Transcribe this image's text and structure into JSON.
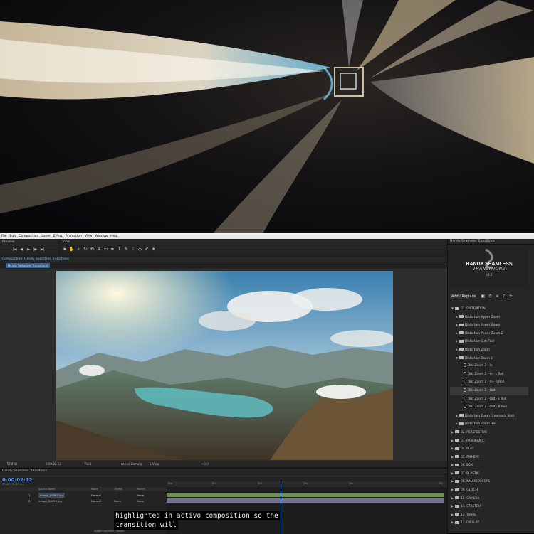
{
  "menu": [
    "File",
    "Edit",
    "Composition",
    "Layer",
    "Effect",
    "Animation",
    "View",
    "Window",
    "Help"
  ],
  "panels": {
    "preview": "Preview",
    "tools": "Tools",
    "composition_tab": "Composition: Handy Seamless Transitions",
    "comp_name": "Handy Seamless Transitions",
    "plugin_panel": "Handy Seamless Transitions"
  },
  "viewer_bar": {
    "zoom": "(52.8%)",
    "time": "0:00:02:12",
    "resolution": "Third",
    "camera": "Active Camera",
    "views": "1 View",
    "offset": "+0.0"
  },
  "plugin": {
    "logo_title": "HANDY SEAMLESS",
    "logo_subtitle": "TRANSITIONS",
    "logo_version": "v3.2",
    "add_replace": "Add / Replace",
    "tree": [
      {
        "label": "01. DISTORTION",
        "type": "folder",
        "open": true,
        "level": 0
      },
      {
        "label": "Distortion Hyper Zoom",
        "type": "folder",
        "level": 1
      },
      {
        "label": "Distortion Power Zoom",
        "type": "folder",
        "level": 1
      },
      {
        "label": "Distortion Power Zoom 2",
        "type": "folder",
        "level": 1
      },
      {
        "label": "Distortion Side Roll",
        "type": "folder",
        "level": 1
      },
      {
        "label": "Distortion Zoom",
        "type": "folder",
        "level": 1
      },
      {
        "label": "Distortion Zoom 2",
        "type": "folder",
        "open": true,
        "level": 1
      },
      {
        "label": "Dist Zoom 2 - In",
        "type": "file",
        "level": 2
      },
      {
        "label": "Dist Zoom 2 - In - L Roll",
        "type": "file",
        "level": 2
      },
      {
        "label": "Dist Zoom 2 - In - R Roll",
        "type": "file",
        "level": 2
      },
      {
        "label": "Dist Zoom 2 - Out",
        "type": "file",
        "level": 2,
        "selected": true
      },
      {
        "label": "Dist Zoom 2 - Out - L Roll",
        "type": "file",
        "level": 2
      },
      {
        "label": "Dist Zoom 2 - Out - R Roll",
        "type": "file",
        "level": 2
      },
      {
        "label": "Distortion Zoom Chromatic Shift",
        "type": "folder",
        "level": 1
      },
      {
        "label": "Distortion Zoom HH",
        "type": "folder",
        "level": 1
      },
      {
        "label": "02. PERSPECTIVE",
        "type": "folder",
        "level": 0
      },
      {
        "label": "03. PANORAMIC",
        "type": "folder",
        "level": 0
      },
      {
        "label": "04. FLAT",
        "type": "folder",
        "level": 0
      },
      {
        "label": "05. FISHEYE",
        "type": "folder",
        "level": 0
      },
      {
        "label": "06. BOX",
        "type": "folder",
        "level": 0
      },
      {
        "label": "07. ELASTIC",
        "type": "folder",
        "level": 0
      },
      {
        "label": "08. KALEIDOSCOPE",
        "type": "folder",
        "level": 0
      },
      {
        "label": "09. GLITCH",
        "type": "folder",
        "level": 0
      },
      {
        "label": "10. CAMERA",
        "type": "folder",
        "level": 0
      },
      {
        "label": "11. STRETCH",
        "type": "folder",
        "level": 0
      },
      {
        "label": "12. TWIRL",
        "type": "folder",
        "level": 0
      },
      {
        "label": "13. DISSLAY",
        "type": "folder",
        "level": 0
      }
    ]
  },
  "timeline": {
    "tab": "Handy Seamless Transitions",
    "time": "0:00:02:12",
    "fps": "00062 (25.00 fps)",
    "columns": [
      "Source Name",
      "Mode",
      "TrkMat",
      "Parent"
    ],
    "layers": [
      {
        "num": "1",
        "name": "Image_00062.jpg",
        "mode": "Normal",
        "trkmat": "",
        "parent": "None"
      },
      {
        "num": "2",
        "name": "Image_00054.jpg",
        "mode": "Normal",
        "trkmat": "None",
        "parent": "None"
      }
    ],
    "ruler": [
      "00s",
      "01s",
      "02s",
      "03s",
      "04s",
      "05s"
    ],
    "footer": "Toggle Switches / Modes"
  },
  "subtitle": [
    "highlighted in activo composition so the",
    "transition will"
  ]
}
